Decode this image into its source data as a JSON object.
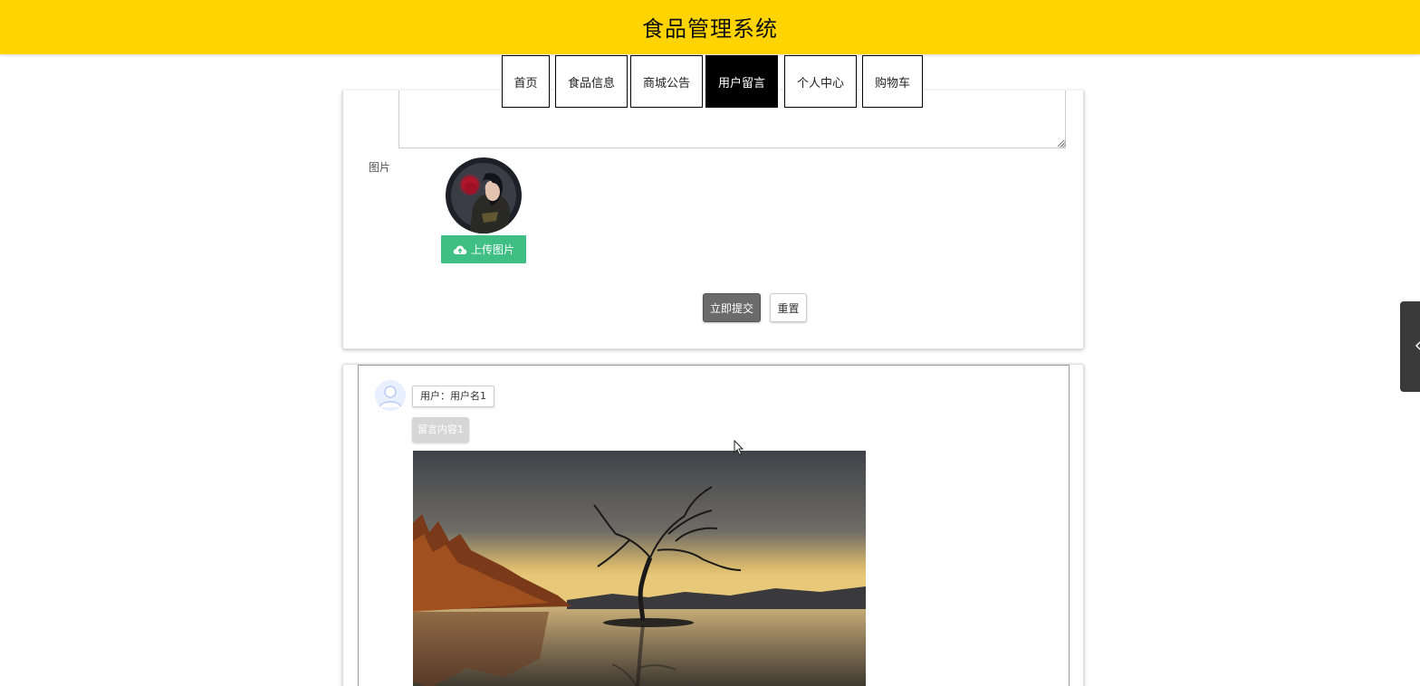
{
  "header": {
    "title": "食品管理系统",
    "color": "#ffd400"
  },
  "nav": {
    "items": [
      {
        "label": "首页",
        "active": false
      },
      {
        "label": "食品信息",
        "active": false
      },
      {
        "label": "商城公告",
        "active": false
      },
      {
        "label": "用户留言",
        "active": true
      },
      {
        "label": "个人中心",
        "active": false
      },
      {
        "label": "购物车",
        "active": false
      }
    ]
  },
  "form": {
    "image_label": "图片",
    "upload_label": "上传图片",
    "submit_label": "立即提交",
    "reset_label": "重置",
    "upload_color": "#3fbf84"
  },
  "comment": {
    "username": "用户：用户名1",
    "content": "留言内容1"
  },
  "icons": {
    "upload": "cloud-upload-icon",
    "side_tab": "chevron-left-icon",
    "avatar": "user-avatar-icon"
  }
}
